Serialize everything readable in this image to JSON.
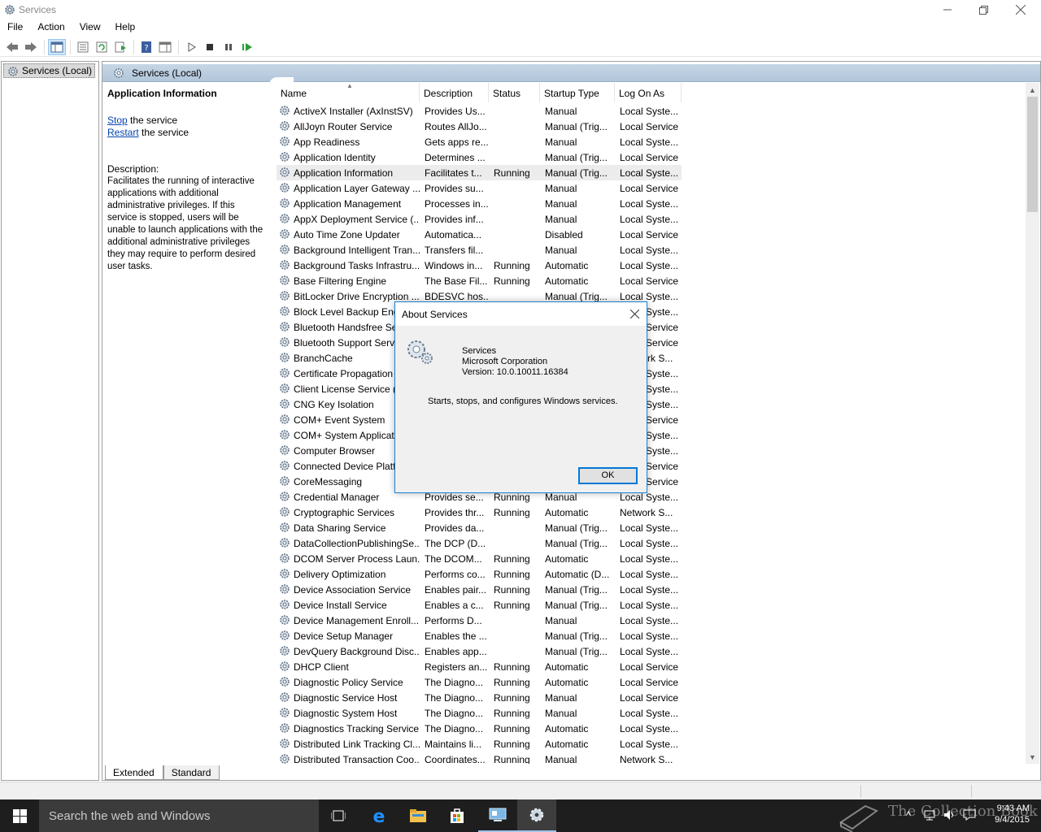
{
  "window": {
    "title": "Services",
    "controls": [
      "minimize",
      "restore",
      "close"
    ]
  },
  "menu": [
    "File",
    "Action",
    "View",
    "Help"
  ],
  "tree": {
    "root_label": "Services (Local)"
  },
  "pane": {
    "header_title": "Services (Local)",
    "detail": {
      "title": "Application Information",
      "stop_link": "Stop",
      "stop_rest": " the service",
      "restart_link": "Restart",
      "restart_rest": " the service",
      "description_label": "Description:",
      "description": "Facilitates the running of interactive applications with additional administrative privileges.  If this service is stopped, users will be unable to launch applications with the additional administrative privileges they may require to perform desired user tasks."
    },
    "columns": [
      "Name",
      "Description",
      "Status",
      "Startup Type",
      "Log On As"
    ],
    "rows": [
      [
        "ActiveX Installer (AxInstSV)",
        "Provides Us...",
        "",
        "Manual",
        "Local Syste..."
      ],
      [
        "AllJoyn Router Service",
        "Routes AllJo...",
        "",
        "Manual (Trig...",
        "Local Service"
      ],
      [
        "App Readiness",
        "Gets apps re...",
        "",
        "Manual",
        "Local Syste..."
      ],
      [
        "Application Identity",
        "Determines ...",
        "",
        "Manual (Trig...",
        "Local Service"
      ],
      [
        "Application Information",
        "Facilitates t...",
        "Running",
        "Manual (Trig...",
        "Local Syste..."
      ],
      [
        "Application Layer Gateway ...",
        "Provides su...",
        "",
        "Manual",
        "Local Service"
      ],
      [
        "Application Management",
        "Processes in...",
        "",
        "Manual",
        "Local Syste..."
      ],
      [
        "AppX Deployment Service (...",
        "Provides inf...",
        "",
        "Manual",
        "Local Syste..."
      ],
      [
        "Auto Time Zone Updater",
        "Automatica...",
        "",
        "Disabled",
        "Local Service"
      ],
      [
        "Background Intelligent Tran...",
        "Transfers fil...",
        "",
        "Manual",
        "Local Syste..."
      ],
      [
        "Background Tasks Infrastru...",
        "Windows in...",
        "Running",
        "Automatic",
        "Local Syste..."
      ],
      [
        "Base Filtering Engine",
        "The Base Fil...",
        "Running",
        "Automatic",
        "Local Service"
      ],
      [
        "BitLocker Drive Encryption ...",
        "BDESVC hos...",
        "",
        "Manual (Trig...",
        "Local Syste..."
      ],
      [
        "Block Level Backup Engine ...",
        "",
        "",
        "",
        "Local Syste..."
      ],
      [
        "Bluetooth Handsfree Service",
        "",
        "",
        "",
        "Local Service"
      ],
      [
        "Bluetooth Support Service",
        "",
        "",
        "",
        "Local Service"
      ],
      [
        "BranchCache",
        "",
        "",
        "",
        "Network S..."
      ],
      [
        "Certificate Propagation",
        "",
        "",
        "",
        "Local Syste..."
      ],
      [
        "Client License Service (C...",
        "",
        "",
        "",
        "Local Syste..."
      ],
      [
        "CNG Key Isolation",
        "",
        "",
        "",
        "Local Syste..."
      ],
      [
        "COM+ Event System",
        "",
        "",
        "",
        "Local Service"
      ],
      [
        "COM+ System Application",
        "",
        "",
        "",
        "Local Syste..."
      ],
      [
        "Computer Browser",
        "",
        "",
        "",
        "Local Syste..."
      ],
      [
        "Connected Device Platform ...",
        "",
        "",
        "",
        "Local Service"
      ],
      [
        "CoreMessaging",
        "",
        "",
        "",
        "Local Service"
      ],
      [
        "Credential Manager",
        "Provides se...",
        "Running",
        "Manual",
        "Local Syste..."
      ],
      [
        "Cryptographic Services",
        "Provides thr...",
        "Running",
        "Automatic",
        "Network S..."
      ],
      [
        "Data Sharing Service",
        "Provides da...",
        "",
        "Manual (Trig...",
        "Local Syste..."
      ],
      [
        "DataCollectionPublishingSe...",
        "The DCP (D...",
        "",
        "Manual (Trig...",
        "Local Syste..."
      ],
      [
        "DCOM Server Process Laun...",
        "The DCOM...",
        "Running",
        "Automatic",
        "Local Syste..."
      ],
      [
        "Delivery Optimization",
        "Performs co...",
        "Running",
        "Automatic (D...",
        "Local Syste..."
      ],
      [
        "Device Association Service",
        "Enables pair...",
        "Running",
        "Manual (Trig...",
        "Local Syste..."
      ],
      [
        "Device Install Service",
        "Enables a c...",
        "Running",
        "Manual (Trig...",
        "Local Syste..."
      ],
      [
        "Device Management Enroll...",
        "Performs D...",
        "",
        "Manual",
        "Local Syste..."
      ],
      [
        "Device Setup Manager",
        "Enables the ...",
        "",
        "Manual (Trig...",
        "Local Syste..."
      ],
      [
        "DevQuery Background Disc...",
        "Enables app...",
        "",
        "Manual (Trig...",
        "Local Syste..."
      ],
      [
        "DHCP Client",
        "Registers an...",
        "Running",
        "Automatic",
        "Local Service"
      ],
      [
        "Diagnostic Policy Service",
        "The Diagno...",
        "Running",
        "Automatic",
        "Local Service"
      ],
      [
        "Diagnostic Service Host",
        "The Diagno...",
        "Running",
        "Manual",
        "Local Service"
      ],
      [
        "Diagnostic System Host",
        "The Diagno...",
        "Running",
        "Manual",
        "Local Syste..."
      ],
      [
        "Diagnostics Tracking Service",
        "The Diagno...",
        "Running",
        "Automatic",
        "Local Syste..."
      ],
      [
        "Distributed Link Tracking Cl...",
        "Maintains li...",
        "Running",
        "Automatic",
        "Local Syste..."
      ],
      [
        "Distributed Transaction Coo...",
        "Coordinates...",
        "Running",
        "Manual",
        "Network S..."
      ]
    ],
    "selected_row": 4,
    "tabs": [
      "Extended",
      "Standard"
    ]
  },
  "dialog": {
    "title": "About Services",
    "product": "Services",
    "company": "Microsoft Corporation",
    "version": "Version: 10.0.10011.16384",
    "description": "Starts, stops, and configures Windows services.",
    "ok_label": "OK"
  },
  "taskbar": {
    "search_placeholder": "Search the web and Windows",
    "apps": [
      "task-view-icon",
      "edge-icon",
      "file-explorer-icon",
      "store-icon",
      "computer-management-icon",
      "services-icon"
    ],
    "time": "9:43 AM",
    "date": "9/4/2015",
    "watermark": "The Collection Book"
  },
  "colors": {
    "accent": "#0078d7",
    "header": "#b9cce0",
    "link": "#0645ad",
    "taskbar": "#1e1e1e"
  }
}
